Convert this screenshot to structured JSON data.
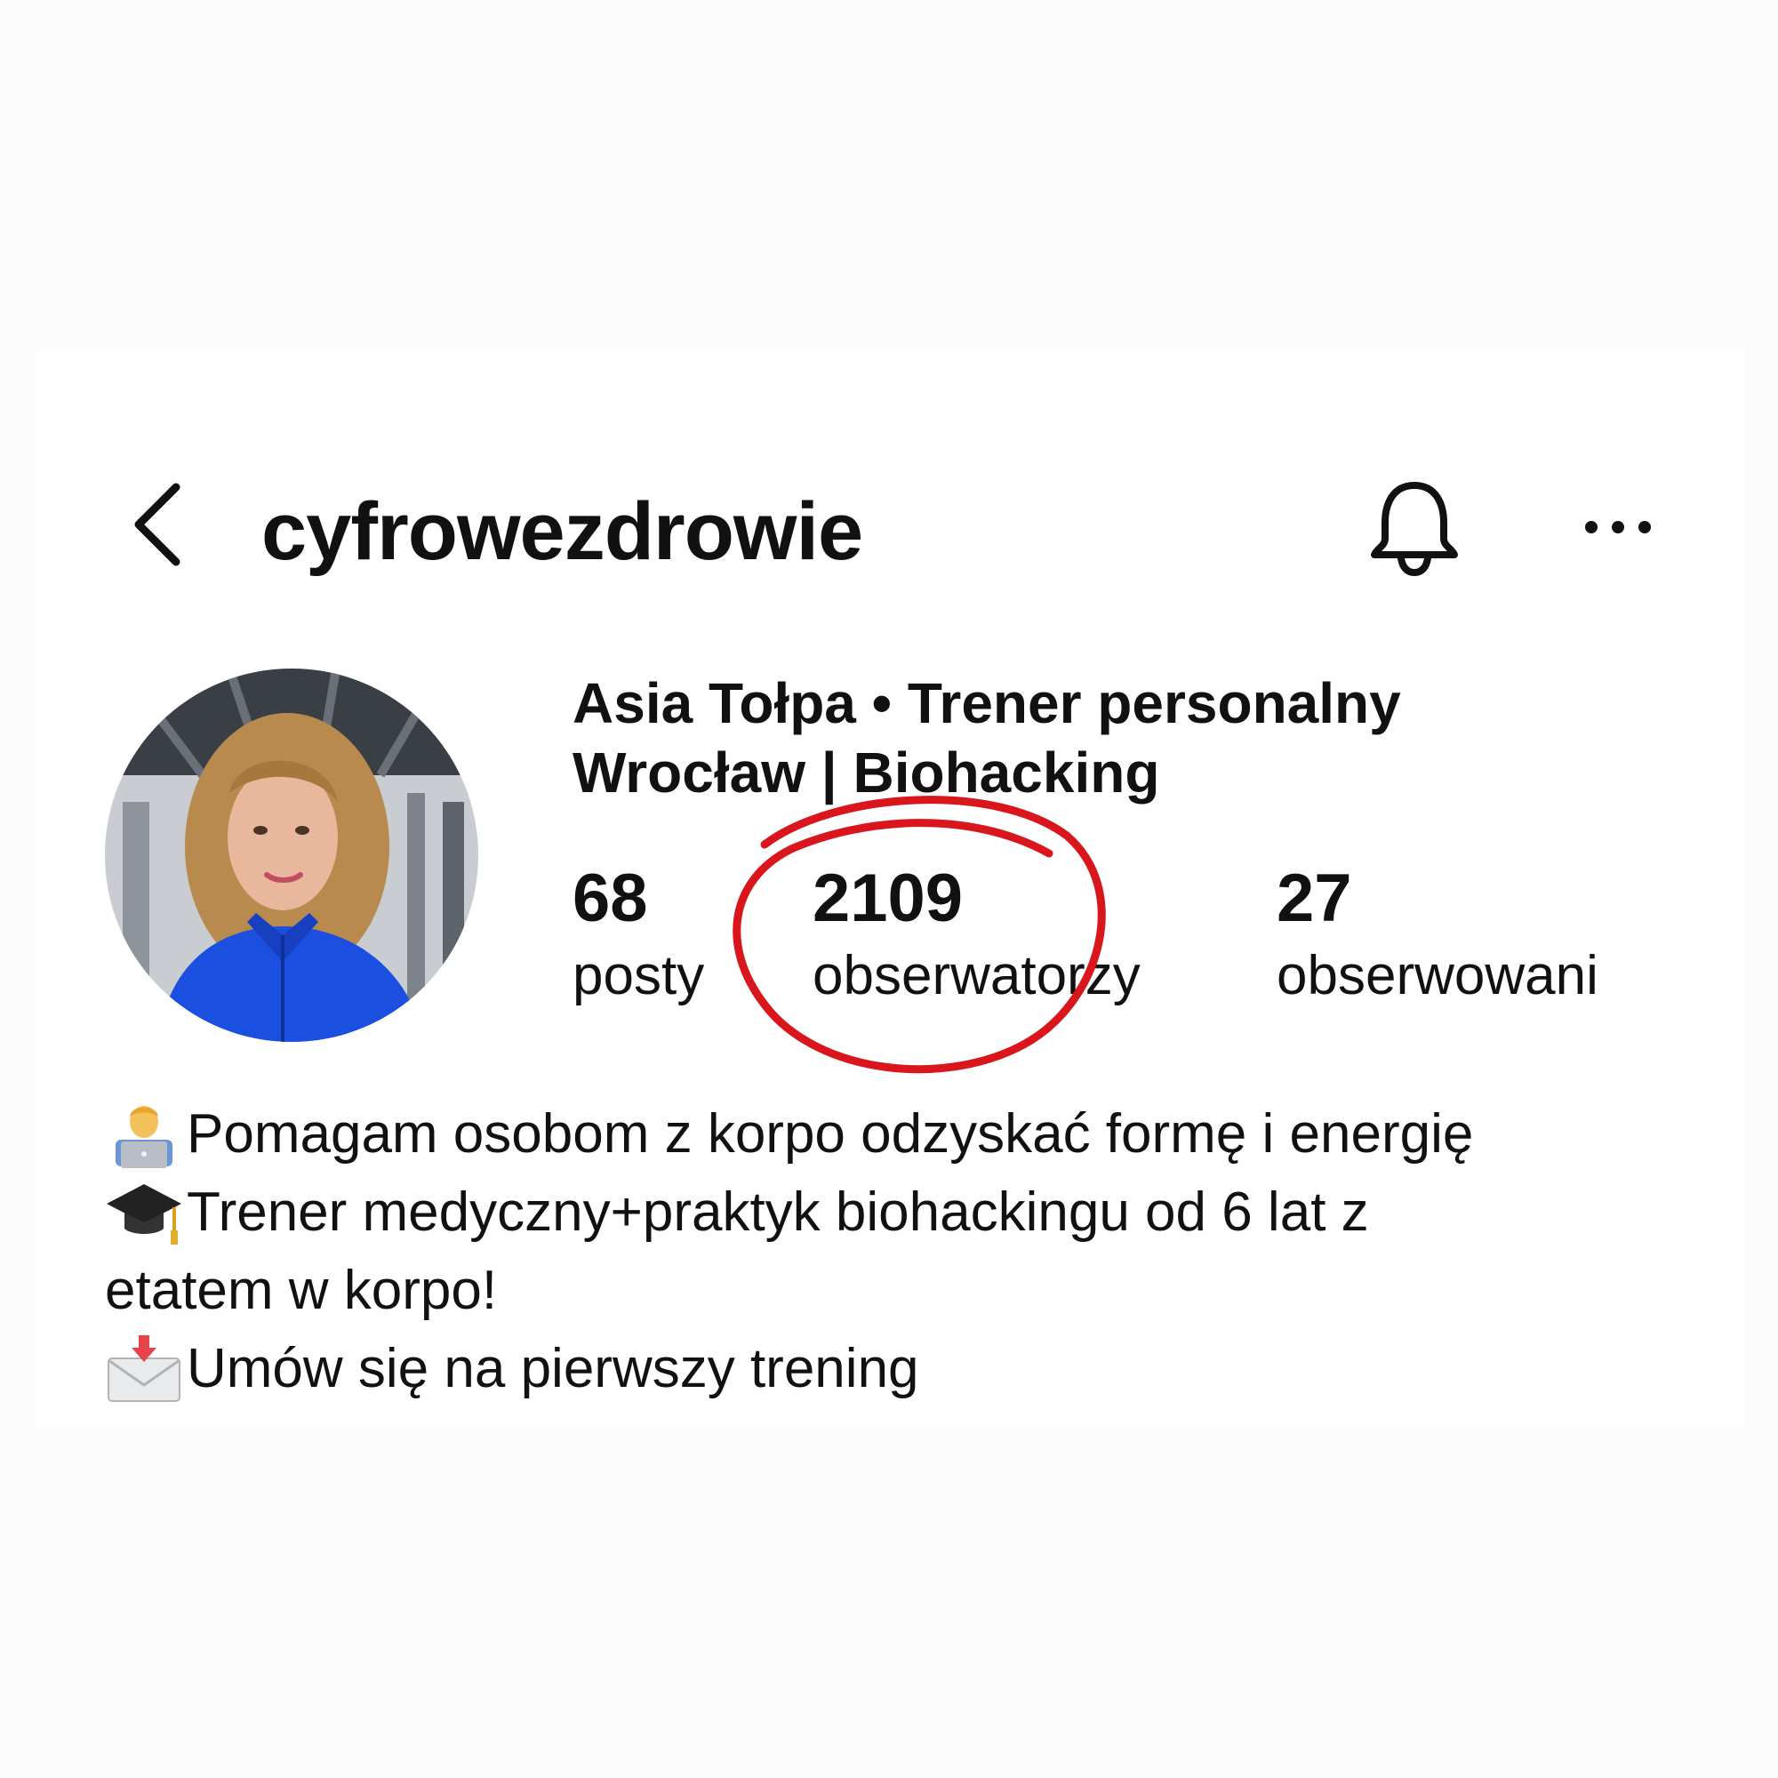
{
  "header": {
    "username": "cyfrowezdrowie",
    "back_icon": "chevron-left-icon",
    "bell_icon": "bell-icon",
    "more_icon": "more-horizontal-icon"
  },
  "profile": {
    "display_name_line1": "Asia Tołpa • Trener personalny",
    "display_name_line2": "Wrocław | Biohacking",
    "stats": [
      {
        "value": "68",
        "label": "posty"
      },
      {
        "value": "2109",
        "label": "obserwatorzy"
      },
      {
        "value": "27",
        "label": "obserwowani"
      }
    ],
    "highlight_color": "#d8161c"
  },
  "bio": {
    "line1": "Pomagam osobom z korpo odzyskać formę i energię",
    "line1_icon": "technologist-icon",
    "line2": "Trener medyczny+praktyk biohackingu od 6 lat z",
    "line2_icon": "graduation-cap-icon",
    "line3": "etatem w korpo!",
    "line4": " Umów się na pierwszy trening",
    "line4_icon": "envelope-arrow-icon"
  }
}
